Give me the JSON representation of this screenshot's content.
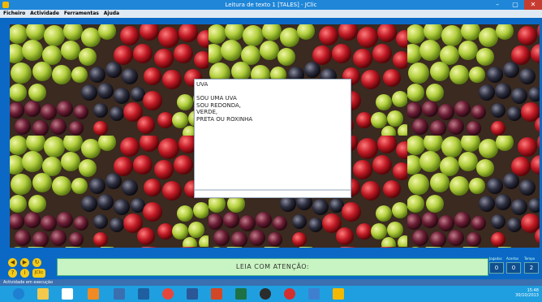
{
  "window": {
    "title": "Leitura de texto 1 [TALES] - JClic",
    "controls": {
      "minimize": "–",
      "maximize": "▢",
      "close": "✕"
    }
  },
  "menu": {
    "items": [
      "Ficheiro",
      "Actividade",
      "Ferramentas",
      "Ajuda"
    ]
  },
  "activity": {
    "text": "UVA\n\nSOU UMA UVA\nSOU REDONDA,\nVERDE,\nPRETA OU ROXINHA"
  },
  "bottom": {
    "message": "LEIA COM ATENÇÃO:",
    "counters": [
      {
        "label": "Jogadas",
        "value": "0"
      },
      {
        "label": "Acertos",
        "value": "0"
      },
      {
        "label": "Tempo",
        "value": "2"
      }
    ]
  },
  "statusbar": {
    "text": "Actividade em execução"
  },
  "taskbar": {
    "clock_time": "15:48",
    "clock_date": "30/10/2013"
  },
  "colors": {
    "titlebar": "#1f86d8",
    "stage": "#0b69c5",
    "message_bg": "#c8f3c2",
    "taskbar": "#1f9fe0"
  }
}
